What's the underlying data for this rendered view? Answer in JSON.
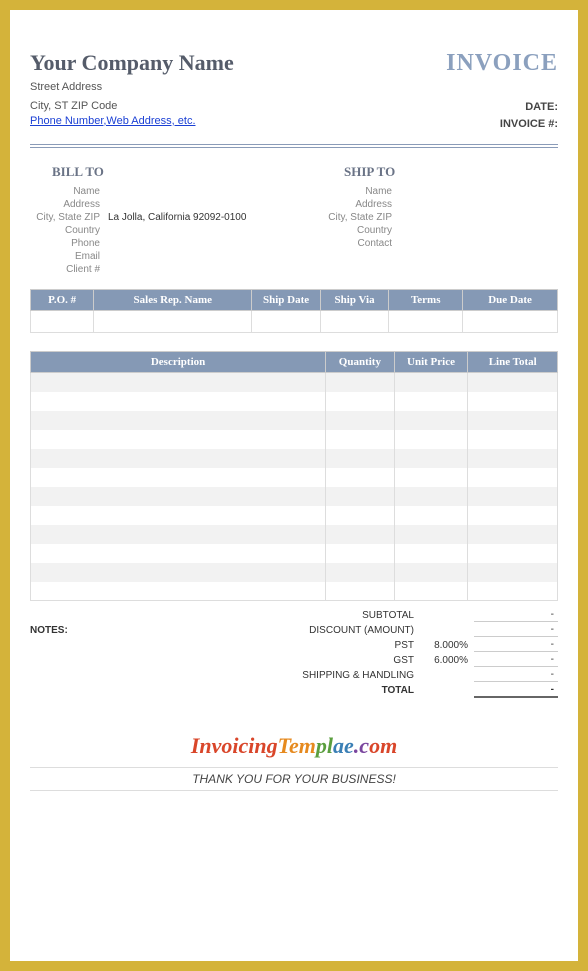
{
  "company": {
    "name": "Your Company Name",
    "street": "Street Address",
    "city_line": "City, ST  ZIP Code",
    "contact_link": "Phone Number,Web Address, etc."
  },
  "invoice_title": "INVOICE",
  "meta": {
    "date_label": "DATE:",
    "invoice_no_label": "INVOICE #:"
  },
  "bill_to": {
    "title": "BILL TO",
    "labels": {
      "name": "Name",
      "address": "Address",
      "city": "City, State ZIP",
      "country": "Country",
      "phone": "Phone",
      "email": "Email",
      "client": "Client #"
    },
    "values": {
      "name": "",
      "address": "",
      "city": "La Jolla, California 92092-0100",
      "country": "",
      "phone": "",
      "email": "",
      "client": ""
    }
  },
  "ship_to": {
    "title": "SHIP TO",
    "labels": {
      "name": "Name",
      "address": "Address",
      "city": "City, State ZIP",
      "country": "Country",
      "contact": "Contact"
    }
  },
  "order_headers": {
    "po": "P.O. #",
    "rep": "Sales Rep. Name",
    "ship_date": "Ship Date",
    "ship_via": "Ship Via",
    "terms": "Terms",
    "due": "Due Date"
  },
  "item_headers": {
    "desc": "Description",
    "qty": "Quantity",
    "unit": "Unit Price",
    "total": "Line Total"
  },
  "totals": {
    "subtotal_label": "SUBTOTAL",
    "subtotal_value": "-",
    "discount_label": "DISCOUNT (AMOUNT)",
    "discount_value": "-",
    "pst_label": "PST",
    "pst_rate": "8.000%",
    "pst_value": "-",
    "gst_label": "GST",
    "gst_rate": "6.000%",
    "gst_value": "-",
    "ship_label": "SHIPPING & HANDLING",
    "ship_value": "-",
    "total_label": "TOTAL",
    "total_value": "-"
  },
  "notes_label": "NOTES:",
  "brand_text": "InvoicingTemplae.com",
  "thanks": "THANK YOU FOR YOUR BUSINESS!"
}
